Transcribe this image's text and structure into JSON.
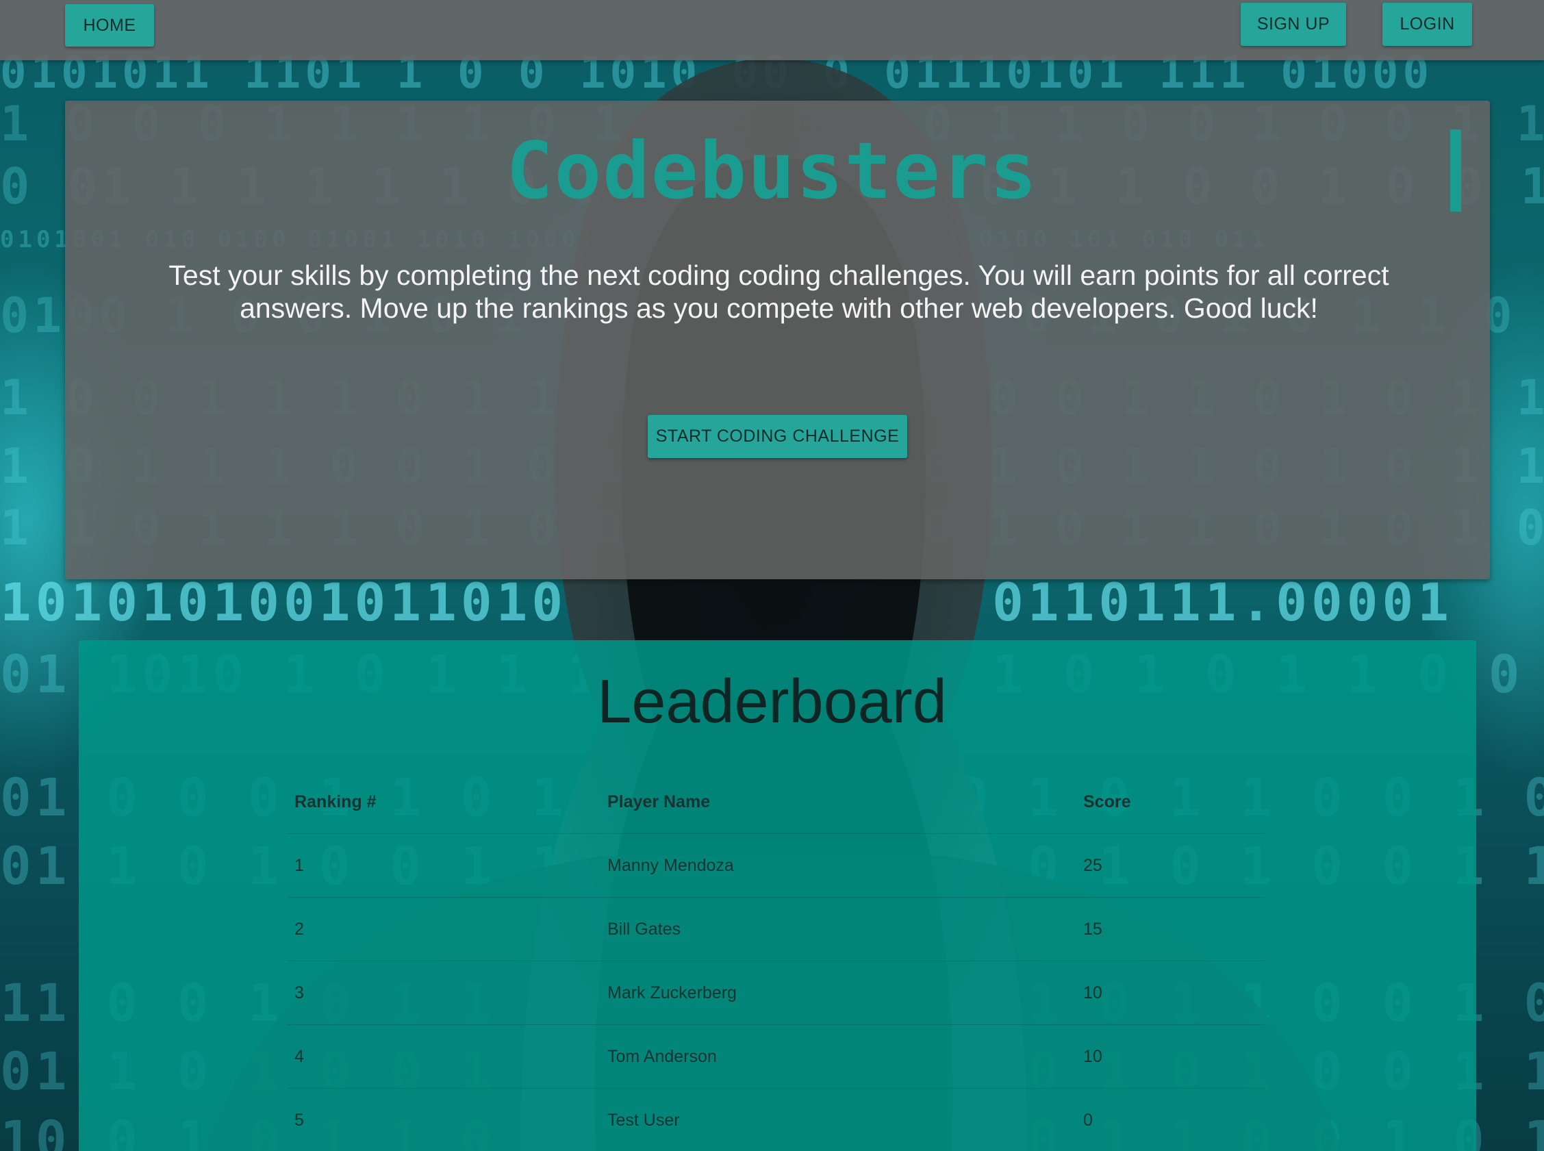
{
  "navbar": {
    "home_label": "HOME",
    "signup_label": "SIGN UP",
    "login_label": "LOGIN"
  },
  "hero": {
    "title": "Codebusters",
    "intro": "Test your skills by completing the next coding coding challenges. You will earn points for all correct answers. Move up the rankings as you compete with other web developers. Good luck!",
    "start_button": "START CODING CHALLENGE"
  },
  "leaderboard": {
    "title": "Leaderboard",
    "columns": [
      "Ranking #",
      "Player Name",
      "Score"
    ],
    "rows": [
      [
        "1",
        "Manny Mendoza",
        "25"
      ],
      [
        "2",
        "Bill Gates",
        "15"
      ],
      [
        "3",
        "Mark Zuckerberg",
        "10"
      ],
      [
        "4",
        "Tom Anderson",
        "10"
      ],
      [
        "5",
        "Test User",
        "0"
      ]
    ]
  },
  "colors": {
    "accent": "#26a69a",
    "title_color": "#1a9c90",
    "leaderboard_bg": "#009688",
    "navbar_bg": "#686868"
  }
}
